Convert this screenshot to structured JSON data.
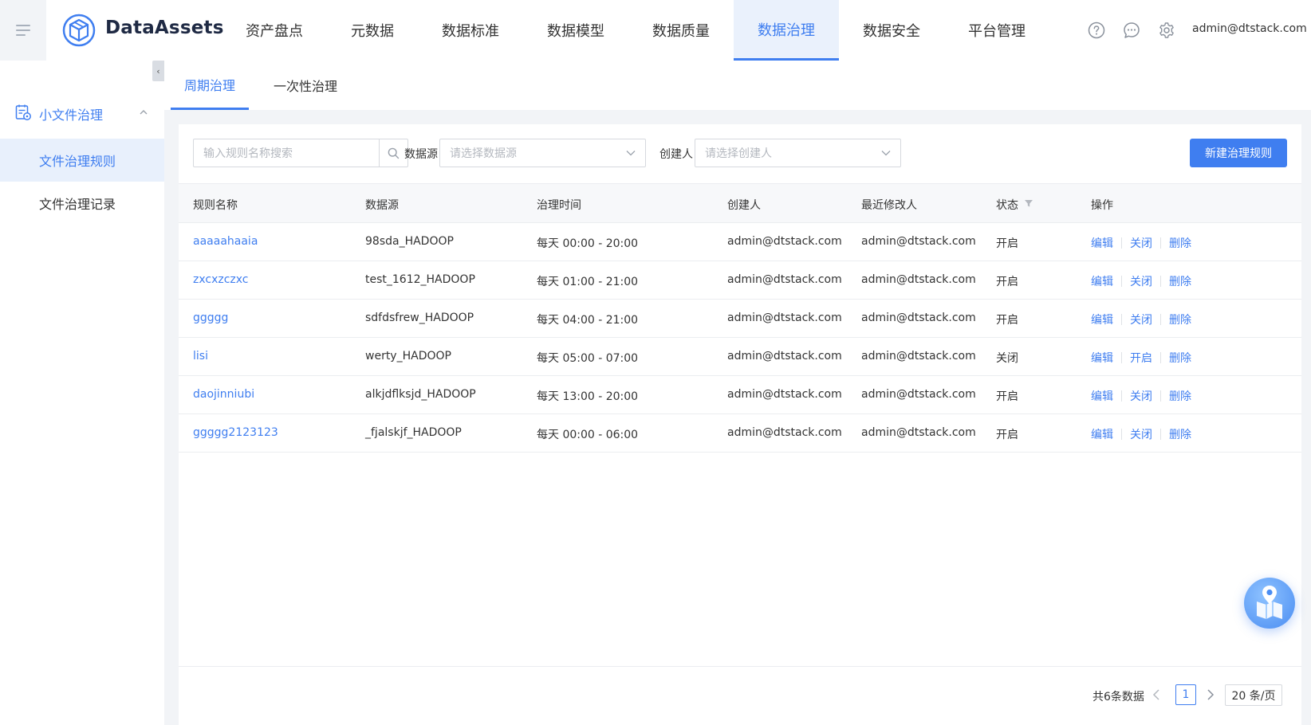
{
  "app": {
    "name": "DataAssets",
    "user": "admin@dtstack.com",
    "accent": "#3f7ef0"
  },
  "nav": {
    "items": [
      {
        "label": "资产盘点",
        "active": false
      },
      {
        "label": "元数据",
        "active": false
      },
      {
        "label": "数据标准",
        "active": false
      },
      {
        "label": "数据模型",
        "active": false
      },
      {
        "label": "数据质量",
        "active": false
      },
      {
        "label": "数据治理",
        "active": true
      },
      {
        "label": "数据安全",
        "active": false
      },
      {
        "label": "平台管理",
        "active": false
      }
    ]
  },
  "sidebar": {
    "group_label": "小文件治理",
    "items": [
      {
        "label": "文件治理规则",
        "active": true
      },
      {
        "label": "文件治理记录",
        "active": false
      }
    ]
  },
  "tabs": [
    {
      "label": "周期治理",
      "active": true
    },
    {
      "label": "一次性治理",
      "active": false
    }
  ],
  "filters": {
    "search_placeholder": "输入规则名称搜索",
    "datasource_label": "数据源",
    "datasource_placeholder": "请选择数据源",
    "creator_label": "创建人",
    "creator_placeholder": "请选择创建人",
    "new_button": "新建治理规则"
  },
  "table": {
    "columns": [
      "规则名称",
      "数据源",
      "治理时间",
      "创建人",
      "最近修改人",
      "状态",
      "操作"
    ],
    "rows": [
      {
        "name": "aaaaahaaia",
        "source": "98sda_HADOOP",
        "time": "每天 00:00 - 20:00",
        "creator": "admin@dtstack.com",
        "modifier": "admin@dtstack.com",
        "status": "开启",
        "ops": [
          "编辑",
          "关闭",
          "删除"
        ]
      },
      {
        "name": "zxcxzczxc",
        "source": "test_1612_HADOOP",
        "time": "每天 01:00 - 21:00",
        "creator": "admin@dtstack.com",
        "modifier": "admin@dtstack.com",
        "status": "开启",
        "ops": [
          "编辑",
          "关闭",
          "删除"
        ]
      },
      {
        "name": "ggggg",
        "source": "sdfdsfrew_HADOOP",
        "time": "每天 04:00 - 21:00",
        "creator": "admin@dtstack.com",
        "modifier": "admin@dtstack.com",
        "status": "开启",
        "ops": [
          "编辑",
          "关闭",
          "删除"
        ]
      },
      {
        "name": "lisi",
        "source": "werty_HADOOP",
        "time": "每天 05:00 - 07:00",
        "creator": "admin@dtstack.com",
        "modifier": "admin@dtstack.com",
        "status": "关闭",
        "ops": [
          "编辑",
          "开启",
          "删除"
        ]
      },
      {
        "name": "daojinniubi",
        "source": "alkjdflksjd_HADOOP",
        "time": "每天 13:00 - 20:00",
        "creator": "admin@dtstack.com",
        "modifier": "admin@dtstack.com",
        "status": "开启",
        "ops": [
          "编辑",
          "关闭",
          "删除"
        ]
      },
      {
        "name": "ggggg2123123",
        "source": "_fjalskjf_HADOOP",
        "time": "每天 00:00 - 06:00",
        "creator": "admin@dtstack.com",
        "modifier": "admin@dtstack.com",
        "status": "开启",
        "ops": [
          "编辑",
          "关闭",
          "删除"
        ]
      }
    ]
  },
  "pagination": {
    "total": "共6条数据",
    "current": "1",
    "page_size": "20 条/页"
  }
}
